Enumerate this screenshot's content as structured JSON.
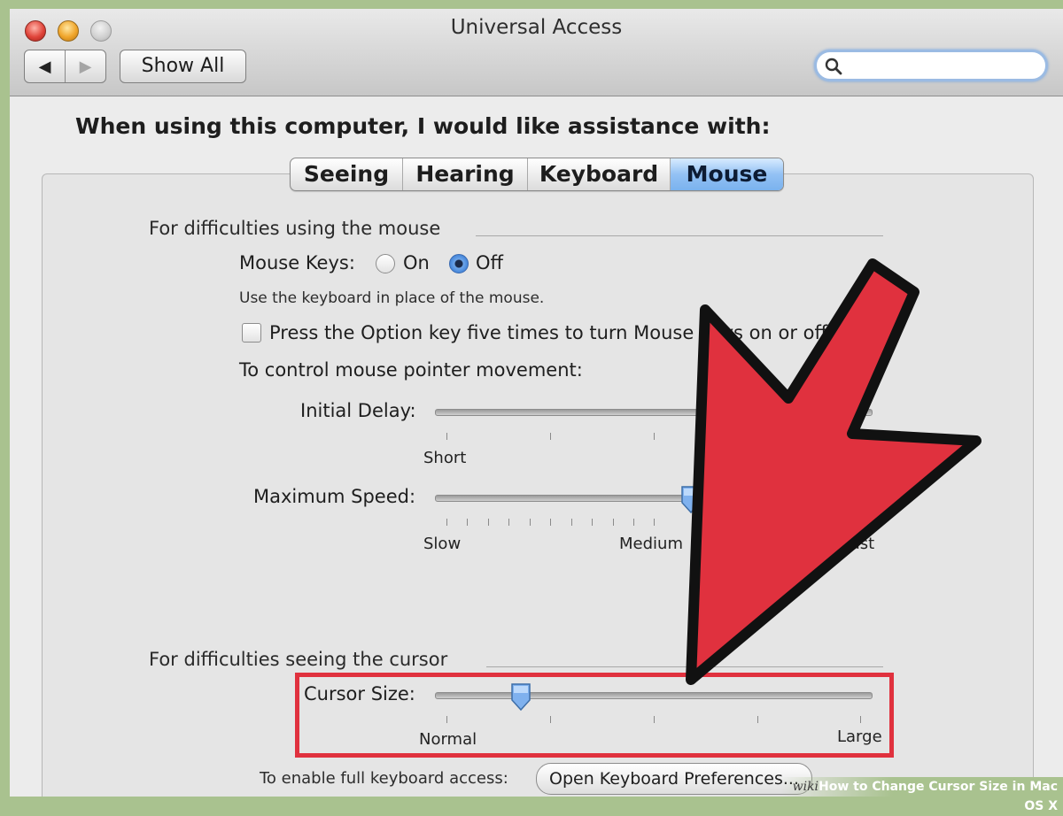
{
  "window": {
    "title": "Universal Access"
  },
  "toolbar": {
    "back_glyph": "◀",
    "forward_glyph": "▶",
    "show_all_label": "Show All",
    "search_placeholder": ""
  },
  "heading": "When using this computer, I would like assistance with:",
  "tabs": [
    {
      "label": "Seeing",
      "selected": false
    },
    {
      "label": "Hearing",
      "selected": false
    },
    {
      "label": "Keyboard",
      "selected": false
    },
    {
      "label": "Mouse",
      "selected": true
    }
  ],
  "mouse_section": {
    "title": "For difficulties using the mouse",
    "mouse_keys_label": "Mouse Keys:",
    "on_label": "On",
    "off_label": "Off",
    "selected": "Off",
    "description": "Use the keyboard in place of the mouse.",
    "option_key_checkbox_label": "Press the Option key five times to turn Mouse Keys on or off",
    "option_key_checked": false,
    "control_label": "To control mouse pointer movement:",
    "initial_delay": {
      "label": "Initial Delay:",
      "min_label": "Short"
    },
    "maximum_speed": {
      "label": "Maximum Speed:",
      "min_label": "Slow",
      "mid_label": "Medium",
      "max_label": "Fast"
    }
  },
  "cursor_section": {
    "title": "For difficulties seeing the cursor",
    "cursor_size": {
      "label": "Cursor Size:",
      "min_label": "Normal",
      "max_label": "Large",
      "value": 0.18
    }
  },
  "keyboard_access": {
    "label": "To enable full keyboard access:",
    "button_label": "Open Keyboard Preferences..."
  },
  "footer": {
    "brand": "wiki",
    "text": "How to Change Cursor Size in Mac OS X"
  },
  "colors": {
    "arrow": "#e0313e",
    "selected_tab": "#7ab2ee",
    "highlight": "#e0313e"
  }
}
